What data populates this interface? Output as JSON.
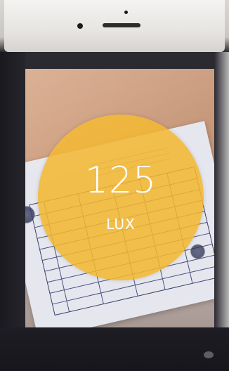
{
  "light_meter": {
    "value": "125",
    "unit": "LUX",
    "circle_color": "#F3B72E"
  },
  "colors": {
    "phone_bezel": "#EDEBE8",
    "phone_body": "#1E1D24",
    "desk": "#C99A7C",
    "paper": "#E6E7EE",
    "ink": "#3A3F68"
  },
  "icons": {
    "front_camera": "camera-lens-icon",
    "speaker": "earpiece-speaker-icon"
  }
}
